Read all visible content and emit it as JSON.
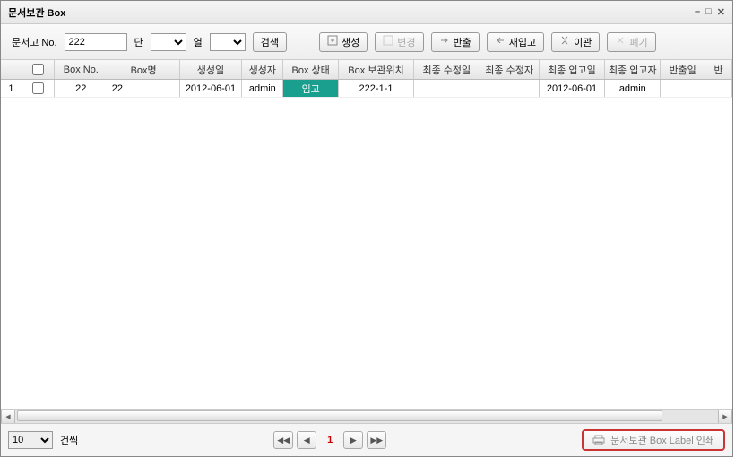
{
  "window": {
    "title": "문서보관 Box"
  },
  "toolbar": {
    "docNoLabel": "문서고 No.",
    "docNoValue": "222",
    "danLabel": "단",
    "danValue": "",
    "yeolLabel": "열",
    "yeolValue": "",
    "searchLabel": "검색",
    "createLabel": "생성",
    "modifyLabel": "변경",
    "exportLabel": "반출",
    "reimportLabel": "재입고",
    "transferLabel": "이관",
    "discardLabel": "폐기"
  },
  "grid": {
    "headers": {
      "boxNo": "Box No.",
      "boxName": "Box명",
      "genDate": "생성일",
      "genBy": "생성자",
      "status": "Box 상태",
      "location": "Box 보관위치",
      "modDate": "최종 수정일",
      "modBy": "최종 수정자",
      "inDate": "최종 입고일",
      "inBy": "최종 입고자",
      "outDate": "반출일",
      "lastCol": "반"
    },
    "rows": [
      {
        "rowNum": "1",
        "boxNo": "22",
        "boxName": "22",
        "genDate": "2012-06-01",
        "genBy": "admin",
        "status": "입고",
        "location": "222-1-1",
        "modDate": "",
        "modBy": "",
        "inDate": "2012-06-01",
        "inBy": "admin",
        "outDate": ""
      }
    ]
  },
  "footer": {
    "pageSize": "10",
    "pageSizeSuffix": "건씩",
    "currentPage": "1",
    "printLabel": "문서보관 Box Label 인쇄"
  }
}
